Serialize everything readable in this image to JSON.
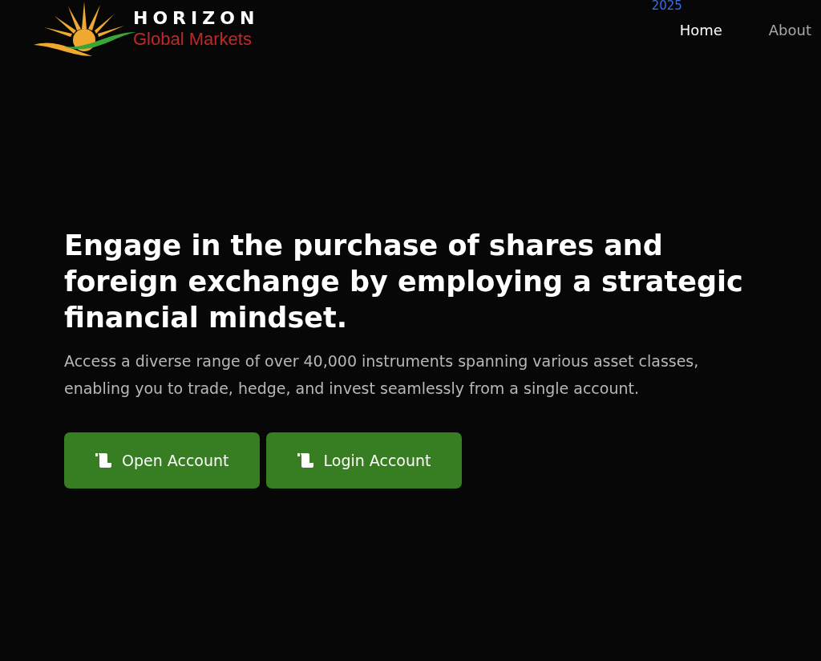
{
  "logo": {
    "name": "HORIZON",
    "tagline": "Global Markets"
  },
  "year": "2025",
  "nav": [
    {
      "label": "Home",
      "selected": true
    },
    {
      "label": "About",
      "selected": false
    }
  ],
  "hero": {
    "title": "Engage in the purchase of shares and foreign exchange by employing a strategic financial mindset.",
    "subtitle": "Access a diverse range of over 40,000 instruments spanning various asset classes, enabling you to trade, hedge, and invest seamlessly from a single account."
  },
  "buttons": [
    "Open Account",
    "Login Account"
  ]
}
